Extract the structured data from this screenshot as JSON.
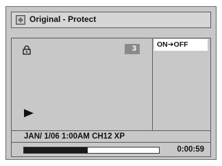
{
  "window": {
    "title": "Original - Protect",
    "title_icon": "disc-original-icon"
  },
  "preview": {
    "lock_icon": "protect-lock-icon",
    "title_number": "3",
    "play_icon": "play-icon"
  },
  "menu": {
    "items": [
      {
        "label": "ON➔OFF"
      }
    ]
  },
  "info": {
    "recording": "JAN/ 1/06 1:00AM CH12 XP"
  },
  "playback": {
    "progress_fraction": 0.47,
    "time": "0:00:59"
  }
}
